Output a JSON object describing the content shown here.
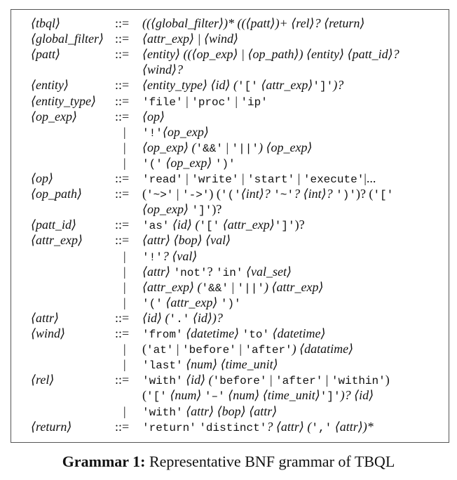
{
  "rows": [
    {
      "nt": "⟨tbql⟩",
      "op": "::=",
      "rhs": [
        [
          "i",
          "((⟨global_filter⟩)* ((⟨patt⟩)+ ⟨rel⟩? ⟨return⟩"
        ]
      ]
    },
    {
      "nt": "⟨global_filter⟩",
      "op": "::=",
      "rhs": [
        [
          "i",
          "⟨attr_exp⟩ | ⟨wind⟩"
        ]
      ]
    },
    {
      "nt": "⟨patt⟩",
      "op": "::=",
      "rhs": [
        [
          "i",
          "⟨entity⟩ ((⟨op_exp⟩ | ⟨op_path⟩) ⟨entity⟩ ⟨patt_id⟩?"
        ]
      ]
    },
    {
      "nt": "",
      "op": "",
      "rhs": [
        [
          "i",
          "⟨wind⟩?"
        ]
      ]
    },
    {
      "nt": "⟨entity⟩",
      "op": "::=",
      "rhs": [
        [
          "i",
          "⟨entity_type⟩ ⟨id⟩ ("
        ],
        [
          "m",
          "'['"
        ],
        [
          "i",
          " ⟨attr_exp⟩"
        ],
        [
          "m",
          "']'"
        ],
        [
          "i",
          ")?"
        ]
      ]
    },
    {
      "nt": "⟨entity_type⟩",
      "op": "::=",
      "rhs": [
        [
          "m",
          "'file'"
        ],
        [
          "t",
          " | "
        ],
        [
          "m",
          "'proc'"
        ],
        [
          "t",
          " | "
        ],
        [
          "m",
          "'ip'"
        ]
      ]
    },
    {
      "nt": "⟨op_exp⟩",
      "op": "::=",
      "rhs": [
        [
          "i",
          "⟨op⟩"
        ]
      ]
    },
    {
      "nt": "",
      "op": "|",
      "rhs": [
        [
          "m",
          "'!'"
        ],
        [
          "i",
          "⟨op_exp⟩"
        ]
      ]
    },
    {
      "nt": "",
      "op": "|",
      "rhs": [
        [
          "i",
          "⟨op_exp⟩ ("
        ],
        [
          "m",
          "'&&'"
        ],
        [
          "t",
          " | "
        ],
        [
          "m",
          "'||'"
        ],
        [
          "i",
          ") ⟨op_exp⟩"
        ]
      ]
    },
    {
      "nt": "",
      "op": "|",
      "rhs": [
        [
          "m",
          "'('"
        ],
        [
          "i",
          " ⟨op_exp⟩ "
        ],
        [
          "m",
          "')'"
        ]
      ]
    },
    {
      "nt": "⟨op⟩",
      "op": "::=",
      "rhs": [
        [
          "m",
          "'read'"
        ],
        [
          "t",
          " | "
        ],
        [
          "m",
          "'write'"
        ],
        [
          "t",
          " | "
        ],
        [
          "m",
          "'start'"
        ],
        [
          "t",
          " | "
        ],
        [
          "m",
          "'execute'"
        ],
        [
          "t",
          "|..."
        ]
      ]
    },
    {
      "nt": "⟨op_path⟩",
      "op": "::=",
      "rhs": [
        [
          "t",
          "("
        ],
        [
          "m",
          "'~>'"
        ],
        [
          "t",
          " | "
        ],
        [
          "m",
          "'->'"
        ],
        [
          "t",
          ") ("
        ],
        [
          "m",
          "'('"
        ],
        [
          "i",
          "⟨int⟩? "
        ],
        [
          "m",
          "'~'"
        ],
        [
          "i",
          "? ⟨int⟩? "
        ],
        [
          "m",
          "')'"
        ],
        [
          "t",
          ")? ("
        ],
        [
          "m",
          "'['"
        ]
      ]
    },
    {
      "nt": "",
      "op": "",
      "rhs": [
        [
          "i",
          "⟨op_exp⟩ "
        ],
        [
          "m",
          "']'"
        ],
        [
          "t",
          ")?"
        ]
      ]
    },
    {
      "nt": "⟨patt_id⟩",
      "op": "::=",
      "rhs": [
        [
          "m",
          "'as'"
        ],
        [
          "i",
          " ⟨id⟩ ("
        ],
        [
          "m",
          "'['"
        ],
        [
          "i",
          " ⟨attr_exp⟩"
        ],
        [
          "m",
          "']'"
        ],
        [
          "t",
          ")?"
        ]
      ]
    },
    {
      "nt": "⟨attr_exp⟩",
      "op": "::=",
      "rhs": [
        [
          "i",
          "⟨attr⟩ ⟨bop⟩ ⟨val⟩"
        ]
      ]
    },
    {
      "nt": "",
      "op": "|",
      "rhs": [
        [
          "m",
          "'!'"
        ],
        [
          "i",
          "? ⟨val⟩"
        ]
      ]
    },
    {
      "nt": "",
      "op": "|",
      "rhs": [
        [
          "i",
          "⟨attr⟩ "
        ],
        [
          "m",
          "'not'"
        ],
        [
          "t",
          "? "
        ],
        [
          "m",
          "'in'"
        ],
        [
          "i",
          " ⟨val_set⟩"
        ]
      ]
    },
    {
      "nt": "",
      "op": "|",
      "rhs": [
        [
          "i",
          "⟨attr_exp⟩ ("
        ],
        [
          "m",
          "'&&'"
        ],
        [
          "t",
          " | "
        ],
        [
          "m",
          "'||'"
        ],
        [
          "i",
          ") ⟨attr_exp⟩"
        ]
      ]
    },
    {
      "nt": "",
      "op": "|",
      "rhs": [
        [
          "m",
          "'('"
        ],
        [
          "i",
          " ⟨attr_exp⟩ "
        ],
        [
          "m",
          "')'"
        ]
      ]
    },
    {
      "nt": "⟨attr⟩",
      "op": "::=",
      "rhs": [
        [
          "i",
          "⟨id⟩ ("
        ],
        [
          "m",
          "'.'"
        ],
        [
          "i",
          " ⟨id⟩)?"
        ]
      ]
    },
    {
      "nt": "⟨wind⟩",
      "op": "::=",
      "rhs": [
        [
          "m",
          "'from'"
        ],
        [
          "i",
          " ⟨datetime⟩ "
        ],
        [
          "m",
          "'to'"
        ],
        [
          "i",
          " ⟨datetime⟩"
        ]
      ]
    },
    {
      "nt": "",
      "op": "|",
      "rhs": [
        [
          "t",
          "("
        ],
        [
          "m",
          "'at'"
        ],
        [
          "t",
          " | "
        ],
        [
          "m",
          "'before'"
        ],
        [
          "t",
          " | "
        ],
        [
          "m",
          "'after'"
        ],
        [
          "i",
          ") ⟨datatime⟩"
        ]
      ]
    },
    {
      "nt": "",
      "op": "|",
      "rhs": [
        [
          "m",
          "'last'"
        ],
        [
          "i",
          " ⟨num⟩ ⟨time_unit⟩"
        ]
      ]
    },
    {
      "nt": "⟨rel⟩",
      "op": "::=",
      "rhs": [
        [
          "m",
          "'with'"
        ],
        [
          "i",
          " ⟨id⟩ ("
        ],
        [
          "m",
          "'before'"
        ],
        [
          "t",
          " | "
        ],
        [
          "m",
          "'after'"
        ],
        [
          "t",
          " | "
        ],
        [
          "m",
          "'within'"
        ],
        [
          "t",
          ")"
        ]
      ]
    },
    {
      "nt": "",
      "op": "",
      "rhs": [
        [
          "t",
          "("
        ],
        [
          "m",
          "'['"
        ],
        [
          "i",
          " ⟨num⟩ "
        ],
        [
          "m",
          "'–'"
        ],
        [
          "i",
          " ⟨num⟩ ⟨time_unit⟩"
        ],
        [
          "m",
          "']'"
        ],
        [
          "i",
          ")? ⟨id⟩"
        ]
      ]
    },
    {
      "nt": "",
      "op": "|",
      "rhs": [
        [
          "m",
          "'with'"
        ],
        [
          "i",
          " ⟨attr⟩ ⟨bop⟩ ⟨attr⟩"
        ]
      ]
    },
    {
      "nt": "⟨return⟩",
      "op": "::=",
      "rhs": [
        [
          "m",
          "'return'"
        ],
        [
          "t",
          " "
        ],
        [
          "m",
          "'distinct'"
        ],
        [
          "i",
          "? ⟨attr⟩ ("
        ],
        [
          "m",
          "','"
        ],
        [
          "i",
          " ⟨attr⟩)*"
        ]
      ]
    }
  ],
  "caption": {
    "label": "Grammar 1:",
    "text": " Representative BNF grammar of TBQL"
  }
}
